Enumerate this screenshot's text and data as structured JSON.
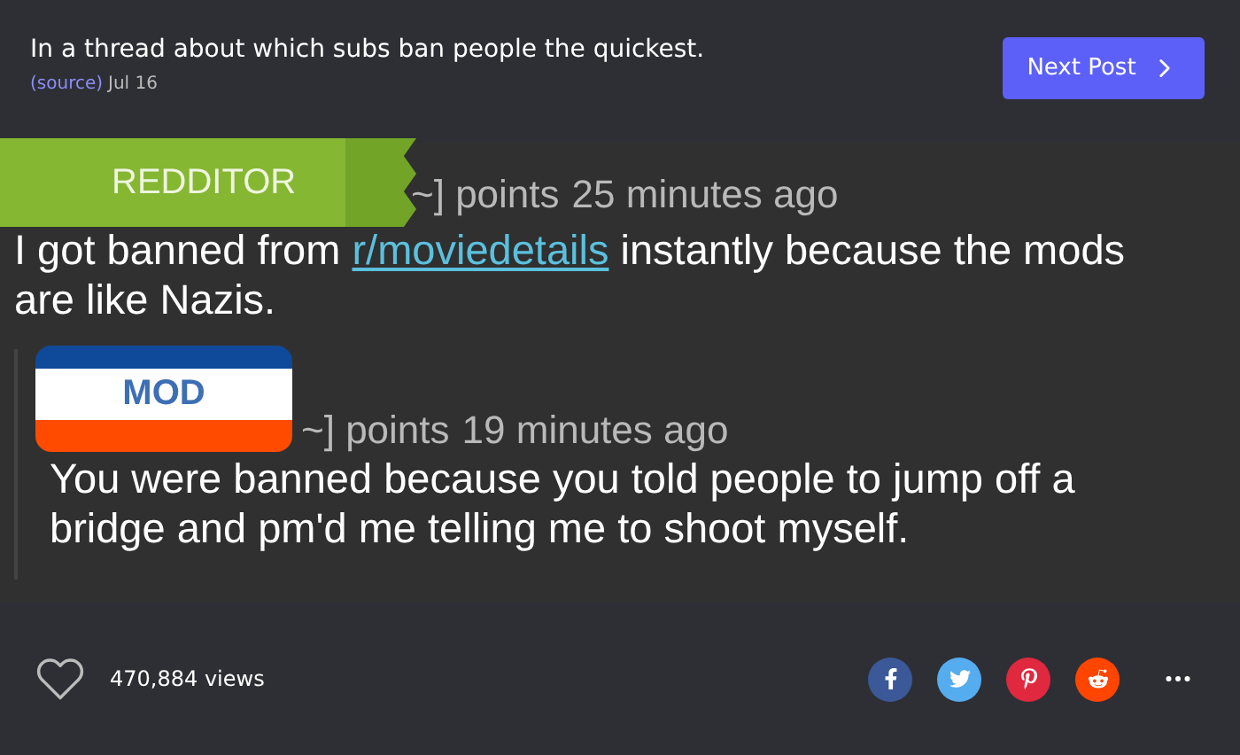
{
  "post": {
    "title": "In a thread about which subs ban people the quickest.",
    "source_link": "(source)",
    "date": "Jul 16",
    "next_button": "Next Post"
  },
  "image": {
    "comments": [
      {
        "sticker": {
          "kind": "redditor",
          "label": "REDDITOR"
        },
        "meta": "~] points",
        "time": "25 minutes ago",
        "body": "I got banned from",
        "link": "r/moviedetails",
        "body_end": "instantly because the mods are like Nazis."
      },
      {
        "sticker": {
          "kind": "mod",
          "label": "MOD"
        },
        "meta": "~] points",
        "time": "19 minutes ago",
        "body": "You were banned because you told people to jump off a bridge and pm'd me telling me to shoot myself."
      }
    ]
  },
  "footer": {
    "views": "470,884 views",
    "share": [
      {
        "kind": "facebook",
        "color": "#3b5998"
      },
      {
        "kind": "twitter",
        "color": "#55acee"
      },
      {
        "kind": "pinterest",
        "color": "#e0283e"
      },
      {
        "kind": "reddit",
        "color": "#ff4500"
      }
    ]
  }
}
